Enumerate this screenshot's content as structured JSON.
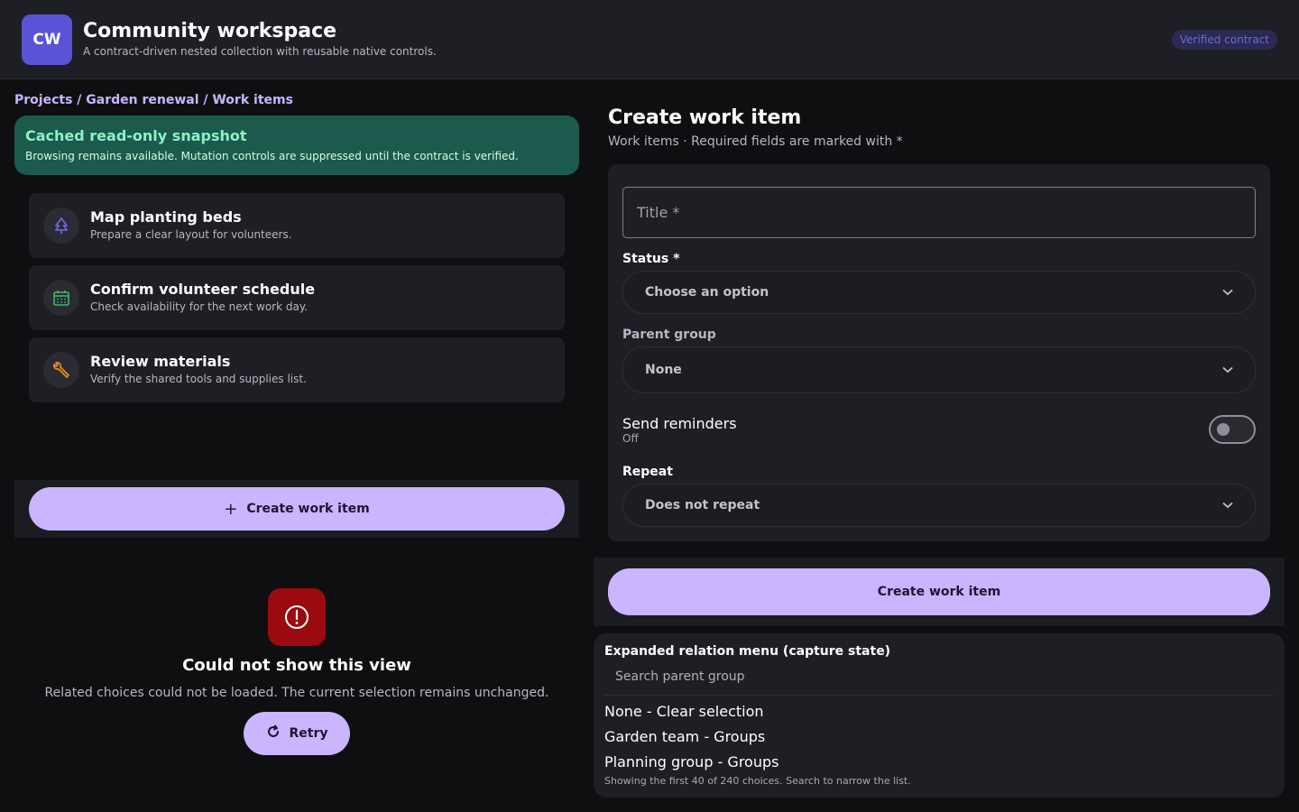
{
  "header": {
    "logo_text": "CW",
    "title": "Community workspace",
    "subtitle": "A contract-driven nested collection with reusable native controls.",
    "badge": "Verified contract"
  },
  "breadcrumb": "Projects / Garden renewal / Work items",
  "snapshot": {
    "title": "Cached read-only snapshot",
    "body": "Browsing remains available. Mutation controls are suppressed until the contract is verified."
  },
  "items": [
    {
      "title": "Map planting beds",
      "description": "Prepare a clear layout for volunteers.",
      "icon": "tree-icon"
    },
    {
      "title": "Confirm volunteer schedule",
      "description": "Check availability for the next work day.",
      "icon": "calendar-icon"
    },
    {
      "title": "Review materials",
      "description": "Verify the shared tools and supplies list.",
      "icon": "wrench-icon"
    }
  ],
  "left_action": {
    "label": "Create work item",
    "icon": "plus-icon"
  },
  "error": {
    "title": "Could not show this view",
    "body": "Related choices could not be loaded. The current selection remains unchanged.",
    "retry_label": "Retry"
  },
  "form": {
    "title": "Create work item",
    "subtitle": "Work items · Required fields are marked with *",
    "title_placeholder": "Title *",
    "status_label": "Status *",
    "status_value": "Choose an option",
    "parent_label": "Parent group",
    "parent_value": "None",
    "reminders_label": "Send reminders",
    "reminders_state": "Off",
    "repeat_label": "Repeat",
    "repeat_value": "Does not repeat",
    "submit_label": "Create work item"
  },
  "menu": {
    "title": "Expanded relation menu (capture state)",
    "search_placeholder": "Search parent group",
    "options": [
      "None - Clear selection",
      "Garden team - Groups",
      "Planning group - Groups"
    ],
    "footer": "Showing the first 40 of 240 choices. Search to narrow the list."
  },
  "colors": {
    "accent": "#cbb5ff",
    "logo": "#5b53d6",
    "snapshot_bg": "#1b5a4c",
    "error": "#9b0a0f"
  }
}
